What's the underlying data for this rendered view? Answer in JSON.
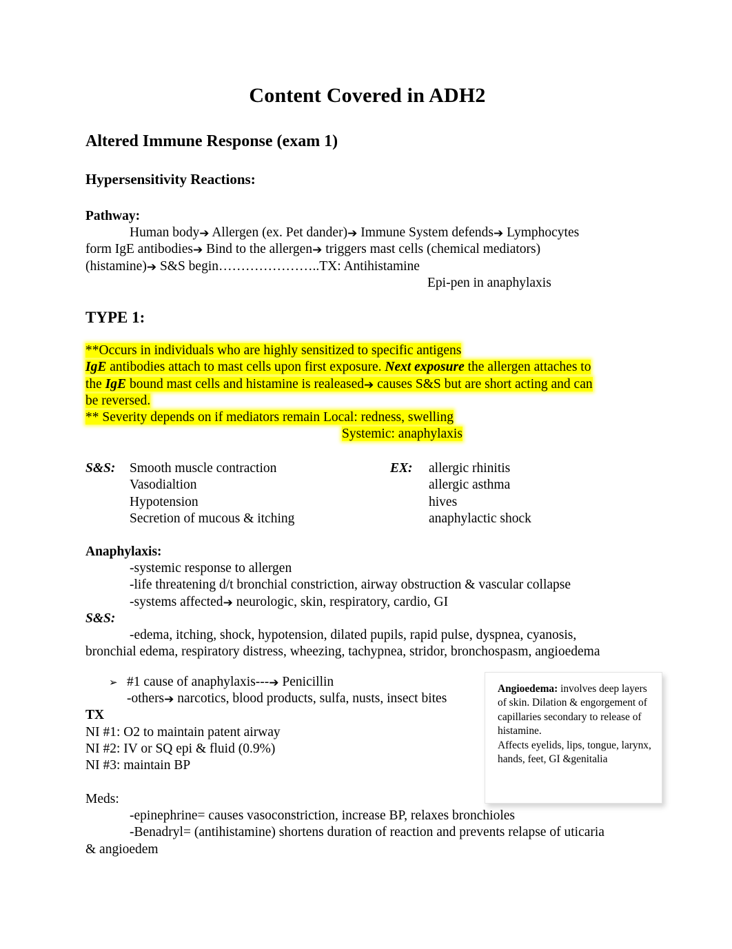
{
  "document": {
    "title": "Content Covered in ADH2",
    "section_heading": "Altered Immune Response (exam 1)",
    "subsection_heading": "Hypersensitivity Reactions:"
  },
  "pathway": {
    "label": "Pathway:",
    "line1_a": "Human body",
    "line1_b": "Allergen (ex. Pet dander)",
    "line1_c": "Immune System defends",
    "line1_d": "Lymphocytes",
    "line2_a": "form IgE antibodies",
    "line2_b": "Bind to the allergen",
    "line2_c": "triggers mast cells (chemical mediators)",
    "line3_a": "(histamine)",
    "line3_b": "S&S begin…………………..TX: Antihistamine",
    "line4": "Epi-pen in anaphylaxis",
    "arrow": "➔"
  },
  "type1": {
    "heading": "TYPE 1:",
    "highlight_lines": [
      "**Occurs in individuals who are highly sensitized to specific antigens",
      "IgE antibodies attach to mast cells upon first exposure. Next exposure the allergen attaches to",
      "the IgE bound mast cells and histamine is realeased causes S&S but are short acting and can",
      "be reversed.",
      "** Severity depends on if mediators remain Local: redness, swelling",
      "Systemic: anaphylaxis"
    ],
    "hl_l1": "**Occurs in individuals who are highly sensitized to specific antigens",
    "hl_l2_ige": "IgE",
    "hl_l2_a": " antibodies attach to mast cells upon first exposure. ",
    "hl_l2_next": "Next exposure",
    "hl_l2_b": " the allergen attaches to",
    "hl_l3_the": "the ",
    "hl_l3_ige": "IgE",
    "hl_l3_a": " bound mast cells and histamine is realeased",
    "hl_l3_b": " causes S&S but are short acting and can",
    "hl_l4": "be reversed.",
    "hl_l5": "** Severity depends on if mediators remain Local: redness, swelling",
    "hl_l6": "Systemic: anaphylaxis",
    "highlight_color": "#ffff00"
  },
  "signs_examples": {
    "ss_label": "S&S:",
    "ex_label": "EX:",
    "ss_values": [
      "Smooth muscle contraction",
      "Vasodialtion",
      "Hypotension",
      "Secretion of mucous & itching"
    ],
    "ex_values": [
      "allergic rhinitis",
      "allergic asthma",
      "hives",
      "anaphylactic shock"
    ]
  },
  "anaphylaxis": {
    "label": "Anaphylaxis:",
    "item1": "-systemic response to allergen",
    "item2": "-life threatening d/t bronchial constriction, airway obstruction & vascular collapse",
    "item3_a": "-systems affected",
    "item3_b": " neurologic, skin, respiratory, cardio, GI",
    "ss_label": "S&S:",
    "ss_line1": "-edema, itching, shock, hypotension, dilated pupils, rapid pulse, dyspnea, cyanosis,",
    "ss_line2": "bronchial edema, respiratory distress, wheezing, tachypnea, stridor, bronchospasm, angioedema"
  },
  "causes": {
    "bullet_glyph": "➢",
    "bullet_a": "#1 cause of anaphylaxis---",
    "bullet_b": " Penicillin",
    "others_a": "-others",
    "others_b": " narcotics, blood products, sulfa, nusts, insect bites"
  },
  "treatment": {
    "tx_label": "TX",
    "ni1": "NI #1:  O2 to maintain patent airway",
    "ni2": "NI #2: IV or SQ epi & fluid (0.9%)",
    "ni3": "NI #3: maintain BP"
  },
  "meds": {
    "label": "Meds:",
    "item1": "-epinephrine= causes vasoconstriction, increase BP, relaxes bronchioles",
    "item2": "-Benadryl= (antihistamine) shortens duration of reaction and prevents relapse of uticaria",
    "item3": "& angioedem"
  },
  "callout": {
    "term": "Angioedema:",
    "body1": " involves deep layers of skin. Dilation & engorgement of capillaries secondary to release of histamine.",
    "body2": "Affects eyelids, lips, tongue, larynx, hands, feet, GI &genitalia"
  }
}
